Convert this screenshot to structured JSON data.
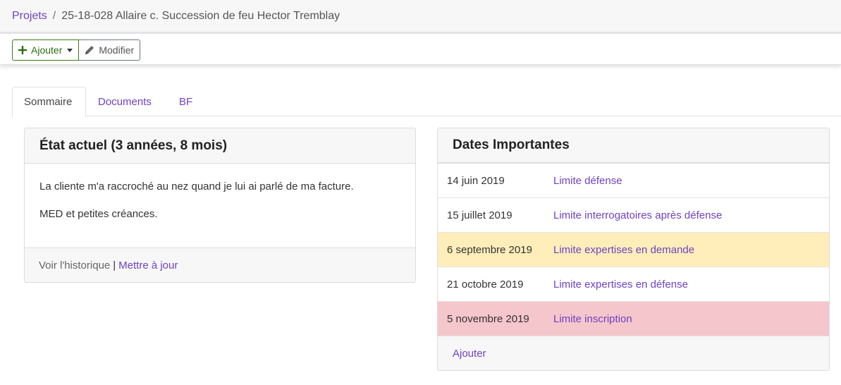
{
  "breadcrumb": {
    "root": "Projets",
    "separator": "/",
    "current": "25-18-028 Allaire c. Succession de feu Hector Tremblay"
  },
  "toolbar": {
    "add_label": "Ajouter",
    "edit_label": "Modifier"
  },
  "tabs": [
    {
      "label": "Sommaire",
      "active": true
    },
    {
      "label": "Documents",
      "active": false
    },
    {
      "label": "BF",
      "active": false
    }
  ],
  "status_card": {
    "title": "État actuel (3 années, 8 mois)",
    "lines": [
      "La cliente m'a raccroché au nez quand je lui ai parlé de ma facture.",
      "MED et petites créances."
    ],
    "history_label": "Voir l'historique",
    "separator": "|",
    "update_label": "Mettre à jour"
  },
  "dates_card": {
    "title": "Dates Importantes",
    "rows": [
      {
        "date": "14 juin 2019",
        "label": "Limite défense",
        "highlight": "#ffffff"
      },
      {
        "date": "15 juillet 2019",
        "label": "Limite interrogatoires après défense",
        "highlight": "#ffffff"
      },
      {
        "date": "6 septembre 2019",
        "label": "Limite expertises en demande",
        "highlight": "#ffeeba"
      },
      {
        "date": "21 octobre 2019",
        "label": "Limite expertises en défense",
        "highlight": "#ffffff"
      },
      {
        "date": "5 novembre 2019",
        "label": "Limite inscription",
        "highlight": "#f5c6cb"
      }
    ],
    "add_label": "Ajouter"
  },
  "colors": {
    "link": "#6f42c1",
    "add_button": "#2f6b12",
    "warning_row": "#ffeeba",
    "danger_row": "#f5c6cb"
  }
}
